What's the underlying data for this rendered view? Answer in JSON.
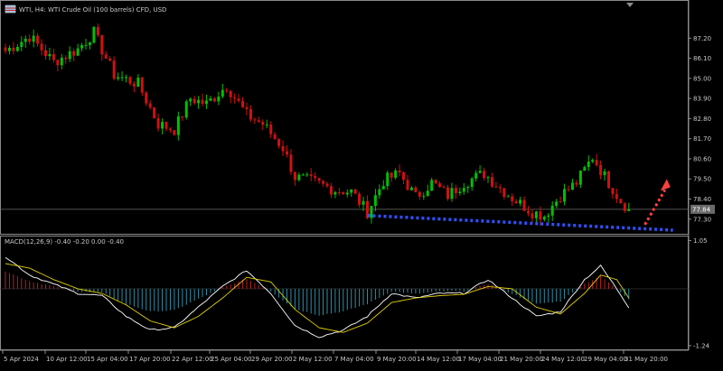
{
  "header": {
    "symbol_title": "WTI, H4: WTI Crude Oil (100 barrels) CFD, USD",
    "macd_label": "MACD(12,26,9) -0.40 -0.20 0.00 -0.40"
  },
  "colors": {
    "background": "#000000",
    "bull": "#00c000",
    "bear": "#d01010",
    "macd_line": "#ffffff",
    "signal_line": "#e0d000",
    "hist_pos": "#b82020",
    "hist_neg": "#2a8fa8",
    "support_line": "#3050ff",
    "projection_arrow": "#ff4040",
    "price_marker_bg": "#6a6a6a"
  },
  "chart_data": [
    {
      "type": "candlestick",
      "title": "WTI, H4: WTI Crude Oil (100 barrels) CFD, USD",
      "y_ticks": [
        87.2,
        86.1,
        85.0,
        83.9,
        82.8,
        81.7,
        80.6,
        79.5,
        78.4,
        77.3
      ],
      "y_tick_labels": [
        "87.20",
        "86.10",
        "85.00",
        "83.90",
        "82.80",
        "81.70",
        "80.60",
        "79.50",
        "78.40",
        "77.30"
      ],
      "ylim": [
        76.55,
        88.3
      ],
      "current_price": 77.84,
      "current_price_label": "77.84",
      "x_tick_labels": [
        "5 Apr 2024",
        "10 Apr 12:00",
        "15 Apr 04:00",
        "17 Apr 20:00",
        "22 Apr 12:00",
        "25 Apr 04:00",
        "29 Apr 20:00",
        "2 May 12:00",
        "7 May 04:00",
        "9 May 20:00",
        "14 May 12:00",
        "17 May 04:00",
        "21 May 20:00",
        "24 May 12:00",
        "29 May 04:00",
        "31 May 20:00"
      ],
      "n_bars": 156,
      "key_closes": [
        {
          "bar": 0,
          "close": 86.5
        },
        {
          "bar": 6,
          "close": 87.3
        },
        {
          "bar": 12,
          "close": 85.9
        },
        {
          "bar": 18,
          "close": 86.6
        },
        {
          "bar": 22,
          "close": 87.5
        },
        {
          "bar": 27,
          "close": 85.2
        },
        {
          "bar": 33,
          "close": 84.7
        },
        {
          "bar": 38,
          "close": 82.5
        },
        {
          "bar": 42,
          "close": 82.2
        },
        {
          "bar": 46,
          "close": 83.9
        },
        {
          "bar": 50,
          "close": 83.6
        },
        {
          "bar": 55,
          "close": 84.6
        },
        {
          "bar": 60,
          "close": 83.0
        },
        {
          "bar": 64,
          "close": 82.5
        },
        {
          "bar": 69,
          "close": 81.2
        },
        {
          "bar": 72,
          "close": 79.6
        },
        {
          "bar": 77,
          "close": 79.3
        },
        {
          "bar": 82,
          "close": 78.9
        },
        {
          "bar": 86,
          "close": 78.8
        },
        {
          "bar": 90,
          "close": 77.7
        },
        {
          "bar": 94,
          "close": 79.4
        },
        {
          "bar": 98,
          "close": 79.8
        },
        {
          "bar": 102,
          "close": 78.5
        },
        {
          "bar": 106,
          "close": 79.3
        },
        {
          "bar": 110,
          "close": 78.6
        },
        {
          "bar": 114,
          "close": 79.3
        },
        {
          "bar": 119,
          "close": 79.8
        },
        {
          "bar": 123,
          "close": 79.0
        },
        {
          "bar": 127,
          "close": 78.3
        },
        {
          "bar": 131,
          "close": 77.7
        },
        {
          "bar": 134,
          "close": 77.5
        },
        {
          "bar": 138,
          "close": 78.6
        },
        {
          "bar": 142,
          "close": 79.3
        },
        {
          "bar": 146,
          "close": 80.7
        },
        {
          "bar": 150,
          "close": 79.3
        },
        {
          "bar": 153,
          "close": 78.3
        },
        {
          "bar": 155,
          "close": 77.84
        }
      ],
      "annotations": [
        {
          "type": "dotted-support-line",
          "from": {
            "bar": 90,
            "price": 77.5
          },
          "to": {
            "bar": 166,
            "price": 76.7
          }
        },
        {
          "type": "projection-arrow",
          "from": {
            "bar": 159,
            "price": 77.0
          },
          "to": {
            "bar": 164,
            "price": 79.2
          }
        }
      ]
    },
    {
      "type": "macd",
      "title": "MACD(12,26,9) -0.40 -0.20 0.00 -0.40",
      "y_ticks": [
        1.05,
        -1.24
      ],
      "y_tick_labels": [
        "1.05",
        "-1.24"
      ],
      "ylim": [
        -1.3,
        1.1
      ],
      "macd_points": [
        [
          0,
          0.7
        ],
        [
          6,
          0.3
        ],
        [
          12,
          0.1
        ],
        [
          18,
          -0.1
        ],
        [
          24,
          -0.15
        ],
        [
          30,
          -0.6
        ],
        [
          36,
          -0.9
        ],
        [
          42,
          -0.85
        ],
        [
          48,
          -0.4
        ],
        [
          54,
          0.05
        ],
        [
          60,
          0.4
        ],
        [
          66,
          -0.1
        ],
        [
          72,
          -0.8
        ],
        [
          78,
          -1.05
        ],
        [
          84,
          -0.9
        ],
        [
          90,
          -0.6
        ],
        [
          96,
          -0.1
        ],
        [
          102,
          -0.2
        ],
        [
          108,
          -0.1
        ],
        [
          114,
          -0.1
        ],
        [
          120,
          0.2
        ],
        [
          126,
          -0.2
        ],
        [
          132,
          -0.6
        ],
        [
          138,
          -0.5
        ],
        [
          144,
          0.2
        ],
        [
          148,
          0.5
        ],
        [
          152,
          0.0
        ],
        [
          155,
          -0.4
        ]
      ],
      "signal_points": [
        [
          0,
          0.55
        ],
        [
          6,
          0.45
        ],
        [
          12,
          0.2
        ],
        [
          18,
          0.0
        ],
        [
          24,
          -0.1
        ],
        [
          30,
          -0.35
        ],
        [
          36,
          -0.7
        ],
        [
          42,
          -0.85
        ],
        [
          48,
          -0.6
        ],
        [
          54,
          -0.2
        ],
        [
          60,
          0.25
        ],
        [
          66,
          0.15
        ],
        [
          72,
          -0.45
        ],
        [
          78,
          -0.85
        ],
        [
          84,
          -0.95
        ],
        [
          90,
          -0.75
        ],
        [
          96,
          -0.3
        ],
        [
          102,
          -0.2
        ],
        [
          108,
          -0.15
        ],
        [
          114,
          -0.12
        ],
        [
          120,
          0.05
        ],
        [
          126,
          0.0
        ],
        [
          132,
          -0.4
        ],
        [
          138,
          -0.55
        ],
        [
          144,
          -0.1
        ],
        [
          148,
          0.3
        ],
        [
          152,
          0.2
        ],
        [
          155,
          -0.2
        ]
      ]
    }
  ]
}
